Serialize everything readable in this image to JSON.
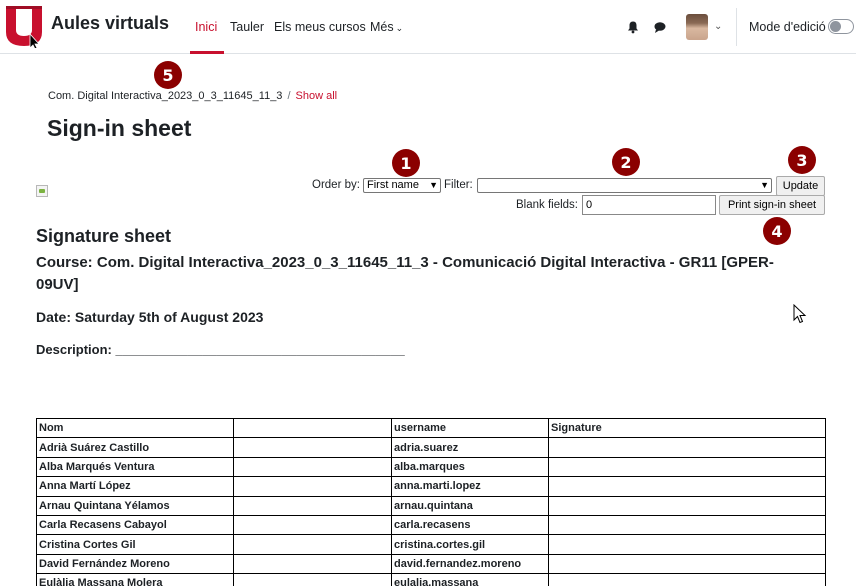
{
  "navbar": {
    "brand": "Aules virtuals",
    "items": [
      {
        "label": "Inici",
        "active": true
      },
      {
        "label": "Tauler"
      },
      {
        "label": "Els meus cursos"
      },
      {
        "label": "Més"
      }
    ],
    "edit_mode_label": "Mode d'edició",
    "accent_color": "#c8102e"
  },
  "breadcrumb": {
    "course": "Com. Digital Interactiva_2023_0_3_11645_11_3",
    "separator": "/",
    "show_all": "Show all"
  },
  "page_title": "Sign-in sheet",
  "badges": [
    "5",
    "1",
    "2",
    "3",
    "4"
  ],
  "controls": {
    "order_by_label": "Order by:",
    "order_by_value": "First name",
    "filter_label": "Filter:",
    "filter_value": "",
    "update_button": "Update",
    "blank_fields_label": "Blank fields:",
    "blank_fields_value": "0",
    "print_button": "Print sign-in sheet"
  },
  "sheet": {
    "title": "Signature sheet",
    "course_label": "Course:",
    "course_value": "Com. Digital Interactiva_2023_0_3_11645_11_3 - Comunicació Digital Interactiva - GR11 [GPER-09UV]",
    "date_label": "Date:",
    "date_value": "Saturday 5th of August 2023",
    "description_label": "Description:",
    "description_line": "________________________________________"
  },
  "table": {
    "headers": [
      "Nom",
      "",
      "username",
      "Signature"
    ],
    "rows": [
      [
        "Adrià Suárez Castillo",
        "",
        "adria.suarez",
        ""
      ],
      [
        "Alba Marqués Ventura",
        "",
        "alba.marques",
        ""
      ],
      [
        "Anna Martí López",
        "",
        "anna.marti.lopez",
        ""
      ],
      [
        "Arnau Quintana Yélamos",
        "",
        "arnau.quintana",
        ""
      ],
      [
        "Carla Recasens Cabayol",
        "",
        "carla.recasens",
        ""
      ],
      [
        "Cristina Cortes Gil",
        "",
        "cristina.cortes.gil",
        ""
      ],
      [
        "David Fernández Moreno",
        "",
        "david.fernandez.moreno",
        ""
      ],
      [
        "Eulàlia Massana Molera",
        "",
        "eulalia.massana",
        ""
      ]
    ]
  }
}
